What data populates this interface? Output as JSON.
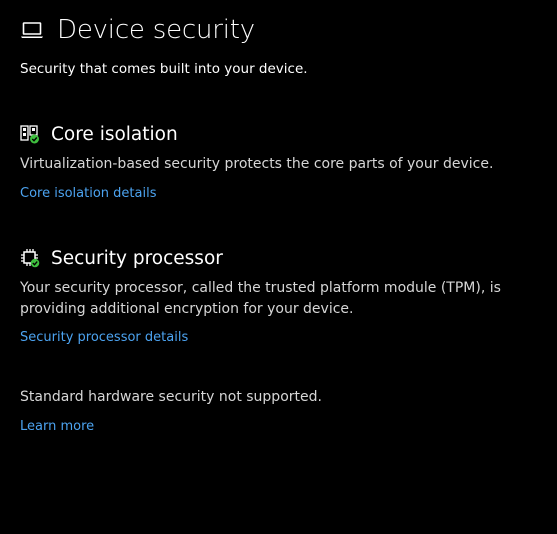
{
  "header": {
    "title": "Device security",
    "subtitle": "Security that comes built into your device.",
    "icon": "laptop-icon"
  },
  "sections": [
    {
      "icon": "core-isolation-icon",
      "title": "Core isolation",
      "description": "Virtualization-based security protects the core parts of your device.",
      "link": "Core isolation details"
    },
    {
      "icon": "chip-icon",
      "title": "Security processor",
      "description": "Your security processor, called the trusted platform module (TPM), is providing additional encryption for your device.",
      "link": "Security processor details"
    }
  ],
  "status": {
    "message": "Standard hardware security not supported.",
    "link": "Learn more"
  },
  "colors": {
    "background": "#000000",
    "link": "#4ca3f0",
    "check_green": "#3fbf3f"
  }
}
